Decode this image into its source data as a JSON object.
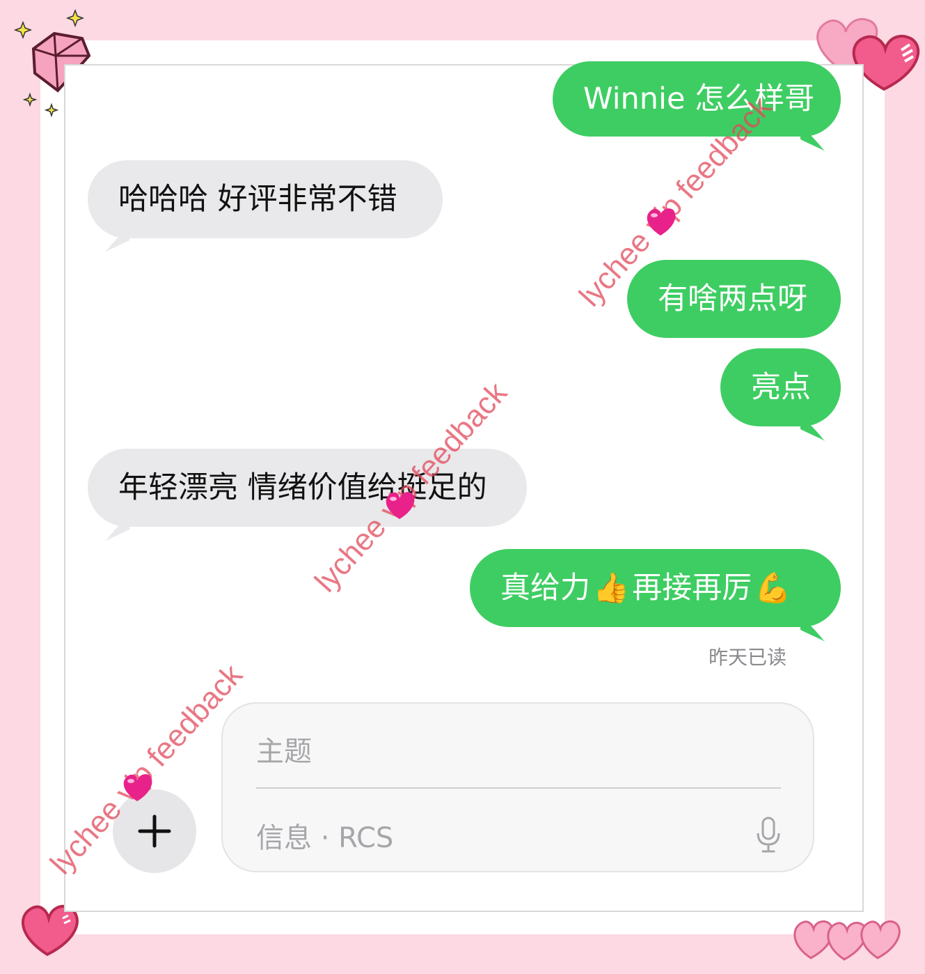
{
  "conversation": {
    "messages": [
      {
        "dir": "sent",
        "text": "Winnie 怎么样哥"
      },
      {
        "dir": "recv",
        "text": "哈哈哈  好评非常不错"
      },
      {
        "dir": "sent",
        "text": "有啥两点呀"
      },
      {
        "dir": "sent",
        "text": "亮点"
      },
      {
        "dir": "recv",
        "text": "年轻漂亮 情绪价值给挺足的"
      },
      {
        "dir": "sent",
        "parts": [
          "真给力",
          "👍",
          " 再接再厉",
          "💪"
        ]
      }
    ],
    "read_receipt": "昨天已读"
  },
  "composer": {
    "subject_placeholder": "主题",
    "message_placeholder": "信息 · RCS",
    "add_icon": "plus-icon",
    "mic_icon": "microphone-icon"
  },
  "watermark": {
    "text": "lychee vip feedback"
  },
  "colors": {
    "sent_bubble": "#3ecd62",
    "recv_bubble": "#e9e9eb",
    "background_pink": "#fcd9e3",
    "watermark": "#e24a5c"
  }
}
